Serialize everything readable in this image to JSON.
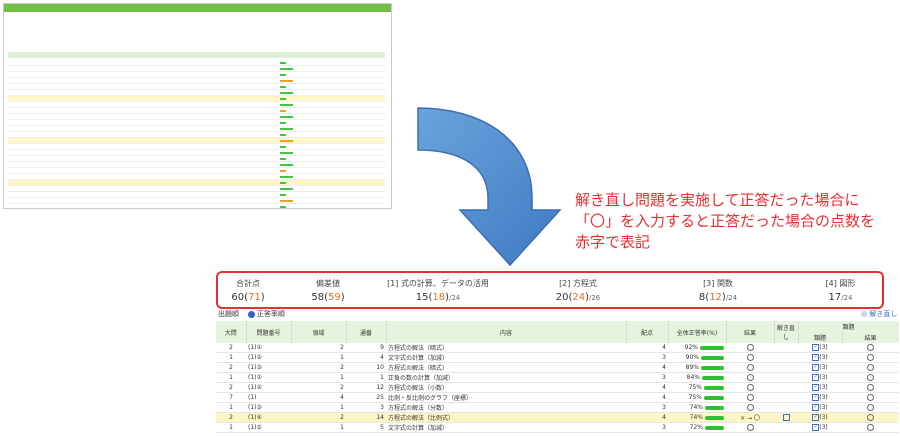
{
  "annotation": {
    "lines": [
      "解き直し問題を実施して正答だった場合に",
      "「〇」を入力すると正答だった場合の点数を",
      "赤字で表記"
    ]
  },
  "summary": [
    {
      "label": "合計点",
      "value": "60",
      "redo": "71",
      "denom": ""
    },
    {
      "label": "偏差値",
      "value": "58",
      "redo": "59",
      "denom": ""
    },
    {
      "label": "[1] 式の計算、データの活用",
      "value": "15",
      "redo": "18",
      "denom": "/24"
    },
    {
      "label": "[2] 方程式",
      "value": "20",
      "redo": "24",
      "denom": "/26"
    },
    {
      "label": "[3] 関数",
      "value": "8",
      "redo": "12",
      "denom": "/24"
    },
    {
      "label": "[4] 図形",
      "value": "17",
      "redo": "",
      "denom": "/24"
    }
  ],
  "filters": {
    "option1": "出題順",
    "option2": "正答率順",
    "redo_link": "解き直し"
  },
  "table": {
    "headers": {
      "major": "大問",
      "qnum": "問題番号",
      "field": "領域",
      "serial": "通番",
      "content": "内容",
      "points": "配点",
      "rate": "全体正答率(%)",
      "result": "結果",
      "redo": "解き直し",
      "group": "類題",
      "similar": "類題",
      "similar_result": "結果"
    },
    "rows": [
      {
        "major": "2",
        "qnum": "(1)①",
        "field": "2",
        "serial": "9",
        "content": "方程式の解法（暗式）",
        "points": "4",
        "rate": "92%",
        "similar": "(3)",
        "style": ""
      },
      {
        "major": "1",
        "qnum": "(1)②",
        "field": "1",
        "serial": "4",
        "content": "文字式の計算（加減）",
        "points": "3",
        "rate": "90%",
        "similar": "(3)",
        "style": ""
      },
      {
        "major": "2",
        "qnum": "(1)③",
        "field": "2",
        "serial": "10",
        "content": "方程式の解法（暗式）",
        "points": "4",
        "rate": "89%",
        "similar": "(3)",
        "style": ""
      },
      {
        "major": "1",
        "qnum": "(1)①",
        "field": "1",
        "serial": "1",
        "content": "正負の数の計算（加減）",
        "points": "3",
        "rate": "84%",
        "similar": "(3)",
        "style": ""
      },
      {
        "major": "2",
        "qnum": "(1)②",
        "field": "2",
        "serial": "12",
        "content": "方程式の解法（小数）",
        "points": "4",
        "rate": "75%",
        "similar": "(3)",
        "style": "sep"
      },
      {
        "major": "7",
        "qnum": "(1)",
        "field": "4",
        "serial": "25",
        "content": "比例・反比例のグラフ（座標）",
        "points": "4",
        "rate": "75%",
        "similar": "(3)",
        "style": ""
      },
      {
        "major": "1",
        "qnum": "(1)③",
        "field": "1",
        "serial": "3",
        "content": "方程式の解法（分数）",
        "points": "3",
        "rate": "74%",
        "similar": "(3)",
        "style": ""
      },
      {
        "major": "2",
        "qnum": "(1)④",
        "field": "2",
        "serial": "14",
        "content": "方程式の解法（比例式）",
        "points": "4",
        "rate": "74%",
        "similar": "(3)",
        "style": "yel",
        "result": "× → 〇"
      },
      {
        "major": "1",
        "qnum": "(1)⑤",
        "field": "1",
        "serial": "5",
        "content": "文字式の計算（加減）",
        "points": "3",
        "rate": "72%",
        "similar": "(3)",
        "style": ""
      }
    ]
  },
  "colors": {
    "accent_red": "#e53030",
    "orange": "#e0701f",
    "green": "#2ec02e",
    "blue": "#3b6fc6",
    "highlight": "#fff6c6"
  }
}
